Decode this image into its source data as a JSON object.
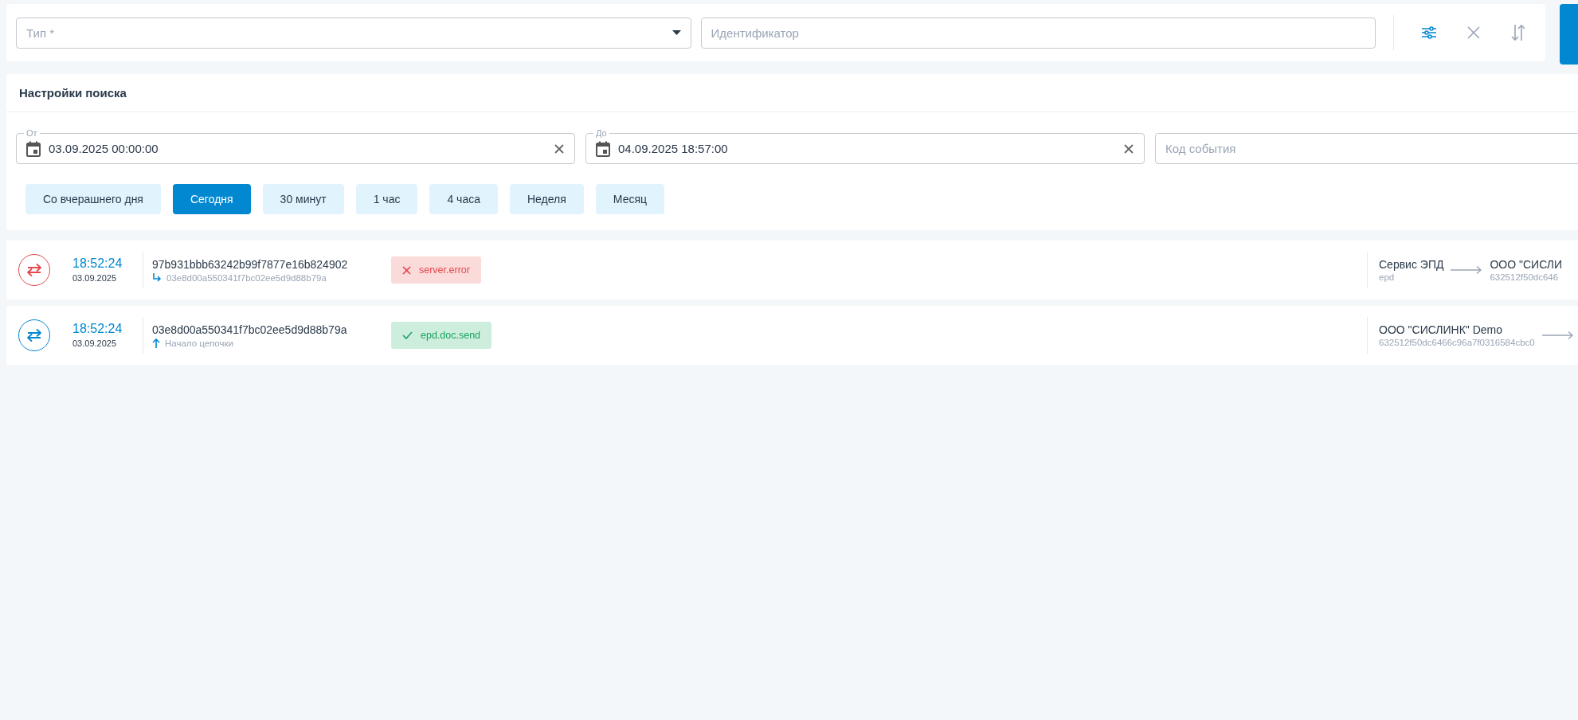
{
  "filter_bar": {
    "type_select": {
      "placeholder": "Тип *"
    },
    "identifier": {
      "placeholder": "Идентификатор"
    }
  },
  "search_settings": {
    "title": "Настройки поиска",
    "date_from": {
      "label": "От",
      "value": "03.09.2025 00:00:00"
    },
    "date_to": {
      "label": "До",
      "value": "04.09.2025 18:57:00"
    },
    "event_code": {
      "placeholder": "Код события"
    },
    "presets": [
      {
        "label": "Со вчерашнего дня",
        "selected": false
      },
      {
        "label": "Сегодня",
        "selected": true
      },
      {
        "label": "30 минут",
        "selected": false
      },
      {
        "label": "1 час",
        "selected": false
      },
      {
        "label": "4 часа",
        "selected": false
      },
      {
        "label": "Неделя",
        "selected": false
      },
      {
        "label": "Месяц",
        "selected": false
      }
    ]
  },
  "events": [
    {
      "kind": "error",
      "time": "18:52:24",
      "date": "03.09.2025",
      "id": "97b931bbb63242b99f7877e16b824902",
      "parent": {
        "kind": "link",
        "text": "03e8d00a550341f7bc02ee5d9d88b79a"
      },
      "event_type": "server.error",
      "from": {
        "name": "Сервис ЭПД",
        "sub": "epd"
      },
      "to": {
        "name": "ООО \"СИСЛИ",
        "sub": "632512f50dc646"
      }
    },
    {
      "kind": "success",
      "time": "18:52:24",
      "date": "03.09.2025",
      "id": "03e8d00a550341f7bc02ee5d9d88b79a",
      "parent": {
        "kind": "chain_start",
        "text": "Начало цепочки"
      },
      "event_type": "epd.doc.send",
      "from": {
        "name": "ООО \"СИСЛИНК\" Demo",
        "sub": "632512f50dc6466c96a7f0316584cbc0"
      }
    }
  ]
}
